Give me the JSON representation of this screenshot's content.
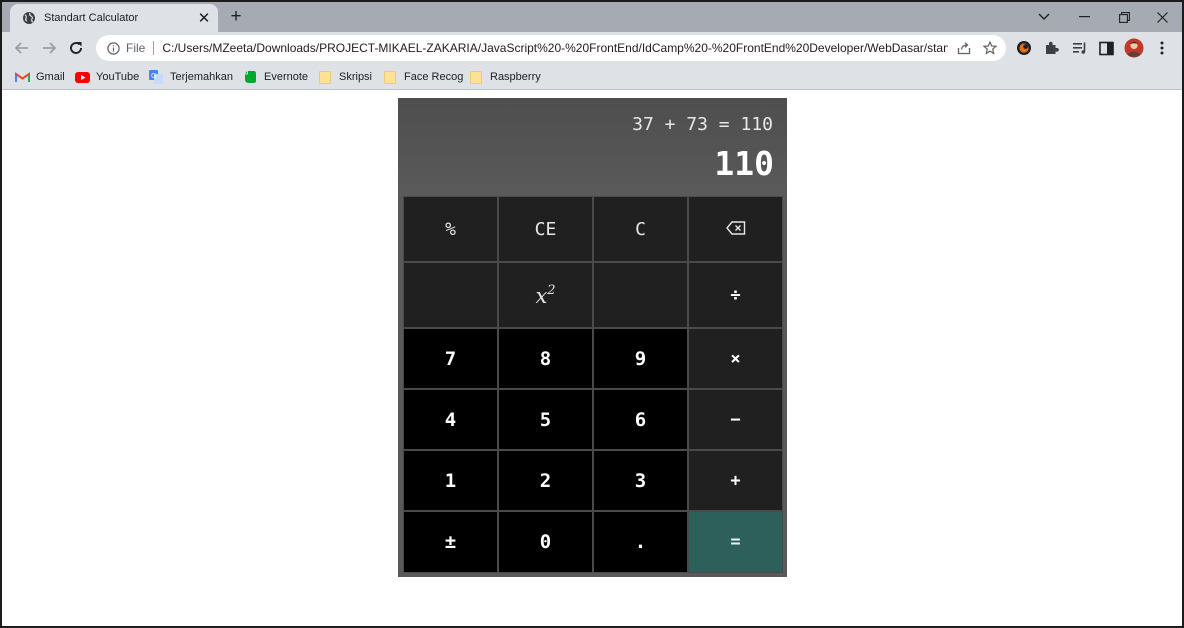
{
  "browser": {
    "tab": {
      "title": "Standart Calculator",
      "close": "✕"
    },
    "new_tab": "+",
    "address": {
      "scheme": "File",
      "url": "C:/Users/MZeeta/Downloads/PROJECT-MIKAEL-ZAKARIA/JavaScript%20-%20FrontEnd/IdCamp%20-%20FrontEnd%20Developer/WebDasar/stand..."
    },
    "bookmarks": [
      {
        "label": "Gmail",
        "icon": "gmail-icon"
      },
      {
        "label": "YouTube",
        "icon": "youtube-icon"
      },
      {
        "label": "Terjemahkan",
        "icon": "translate-icon"
      },
      {
        "label": "Evernote",
        "icon": "evernote-icon"
      },
      {
        "label": "Skripsi",
        "icon": "folder-icon"
      },
      {
        "label": "Face Recog",
        "icon": "folder-icon"
      },
      {
        "label": "Raspberry",
        "icon": "folder-icon"
      }
    ]
  },
  "calculator": {
    "history": "37 + 73 = 110",
    "result": "110",
    "keys": {
      "percent": "%",
      "clear_entry": "CE",
      "clear": "C",
      "backspace": "backspace-icon",
      "square_base": "x",
      "square_exp": "2",
      "divide": "÷",
      "seven": "7",
      "eight": "8",
      "nine": "9",
      "multiply": "×",
      "four": "4",
      "five": "5",
      "six": "6",
      "minus": "−",
      "one": "1",
      "two": "2",
      "three": "3",
      "plus": "+",
      "negate": "±",
      "zero": "0",
      "decimal": ".",
      "equals": "="
    }
  },
  "colors": {
    "calculator_bg": "#595959",
    "function_key": "#202020",
    "number_key": "#000000",
    "equals_key": "#2d5f5b",
    "browser_frame": "#dee1e6"
  }
}
